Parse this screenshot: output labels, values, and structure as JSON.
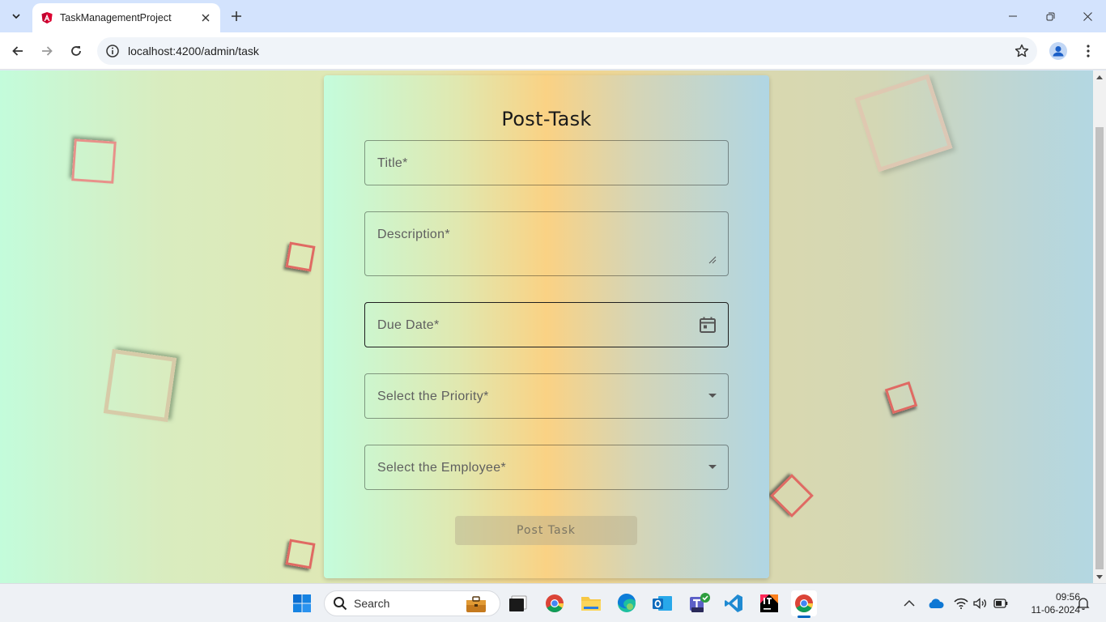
{
  "browser": {
    "tab_title": "TaskManagementProject",
    "url": "localhost:4200/admin/task"
  },
  "form": {
    "heading": "Post-Task",
    "title_label": "Title*",
    "description_label": "Description*",
    "due_date_label": "Due Date*",
    "priority_label": "Select the Priority*",
    "employee_label": "Select the Employee*",
    "submit_label": "Post Task"
  },
  "taskbar": {
    "search_label": "Search",
    "time": "09:56",
    "date": "11-06-2024"
  },
  "icons": [
    "tab-search-icon",
    "angular-favicon-icon",
    "close-icon",
    "plus-icon",
    "minimize-icon",
    "restore-icon",
    "close-window-icon",
    "back-icon",
    "forward-icon",
    "reload-icon",
    "site-info-icon",
    "bookmark-star-icon",
    "profile-icon",
    "menu-dots-icon",
    "calendar-icon",
    "dropdown-arrow-icon",
    "windows-start-icon",
    "search-icon",
    "briefcase-icon",
    "task-view-icon",
    "chrome-icon",
    "file-explorer-icon",
    "edge-icon",
    "outlook-icon",
    "teams-icon",
    "vscode-icon",
    "intellij-icon",
    "chevron-up-icon",
    "onedrive-icon",
    "wifi-icon",
    "volume-icon",
    "battery-icon",
    "notification-bell-icon"
  ],
  "colors": {
    "deco_red": "#e06a63",
    "deco_tan": "#d6c6a6",
    "chrome_tab_bg": "#d3e3fd"
  }
}
